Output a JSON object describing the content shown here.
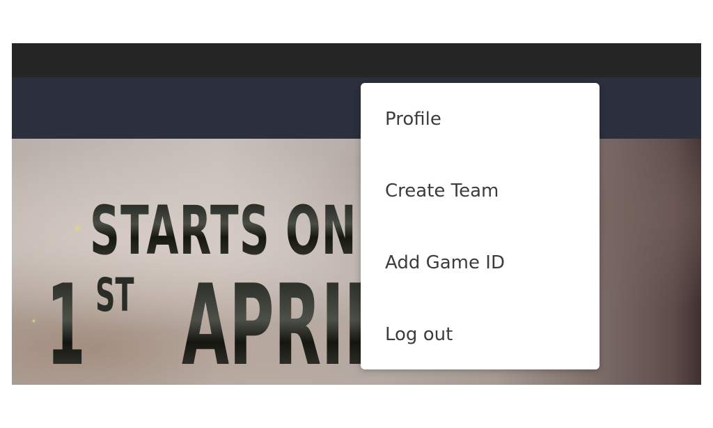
{
  "hero": {
    "headline": "STARTS ON",
    "date_day": "1",
    "date_suffix": "ST",
    "date_month": "APRIL"
  },
  "dropdown": {
    "items": [
      {
        "label": "Profile"
      },
      {
        "label": "Create Team"
      },
      {
        "label": "Add Game ID"
      },
      {
        "label": "Log out"
      }
    ]
  },
  "colors": {
    "topbar": "#252525",
    "navbar": "#2c303d",
    "dropdown_bg": "#ffffff",
    "menu_text": "#3c3c3c"
  }
}
